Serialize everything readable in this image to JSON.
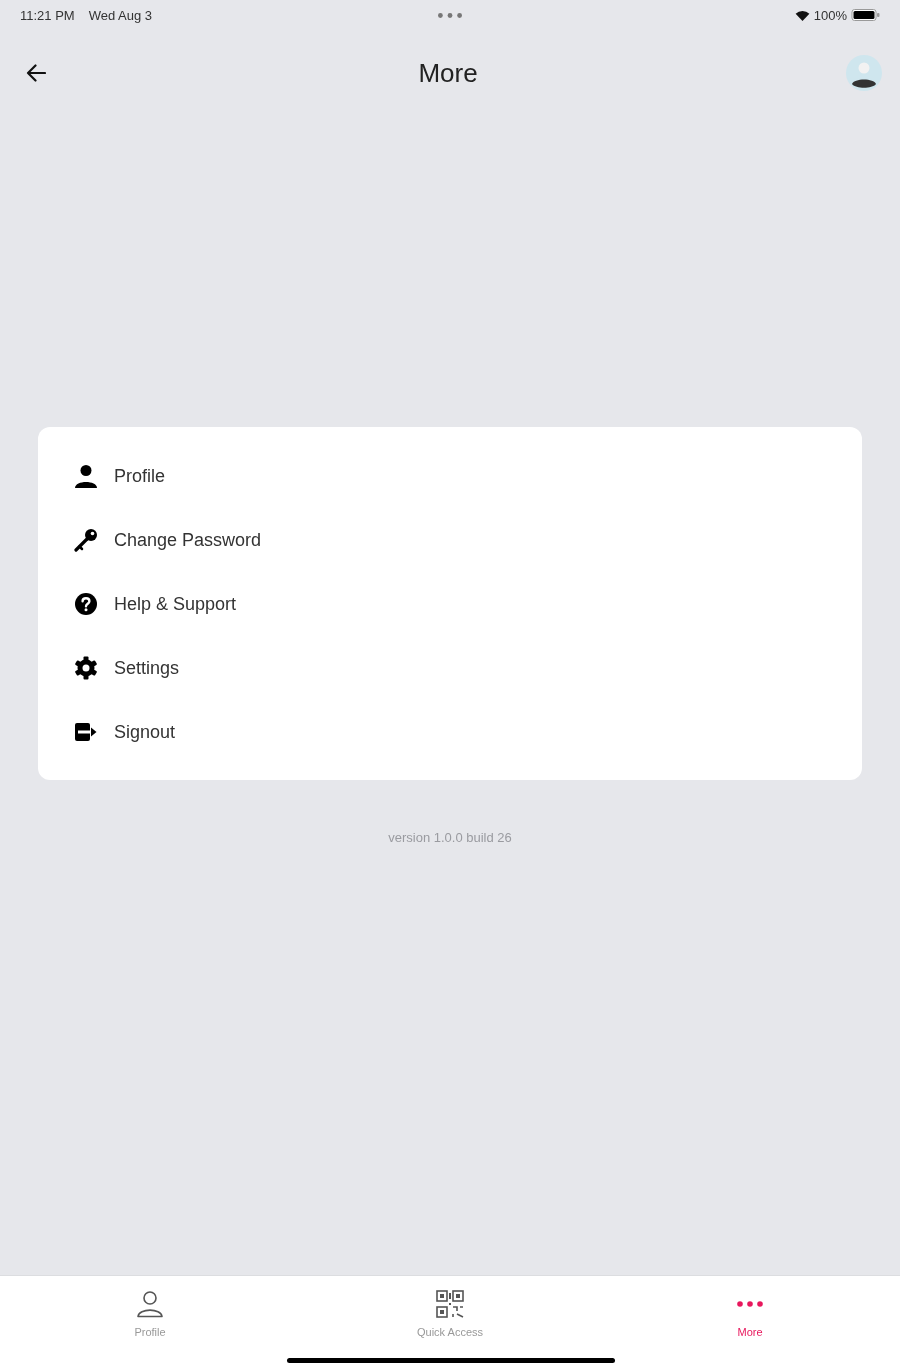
{
  "status_bar": {
    "time": "11:21 PM",
    "date": "Wed Aug 3",
    "battery": "100%"
  },
  "header": {
    "title": "More"
  },
  "menu": [
    {
      "label": "Profile",
      "kind": "person"
    },
    {
      "label": "Change Password",
      "kind": "key"
    },
    {
      "label": "Help & Support",
      "kind": "help"
    },
    {
      "label": "Settings",
      "kind": "gear"
    },
    {
      "label": "Signout",
      "kind": "exit"
    }
  ],
  "version": "version 1.0.0 build 26",
  "tab_bar": [
    {
      "label": "Profile",
      "kind": "person",
      "selected": false
    },
    {
      "label": "Quick Access",
      "kind": "qr",
      "selected": false
    },
    {
      "label": "More",
      "kind": "more",
      "selected": true
    }
  ]
}
